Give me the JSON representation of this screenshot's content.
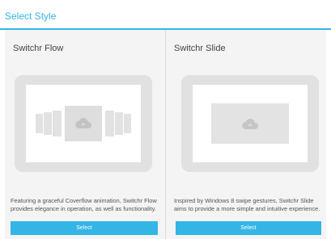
{
  "header": {
    "title": "Select Style"
  },
  "colors": {
    "accent": "#33b5e5"
  },
  "panels": [
    {
      "title": "Switchr Flow",
      "description": "Featuring a graceful Coverflow animation, Switchr Flow provides elegance in operation, as well as functionality.",
      "button_label": "Select",
      "icon": "cloud-icon"
    },
    {
      "title": "Switchr Slide",
      "description": "Inspired by Windows 8 swipe gestures, Switchr Slide aims to provide a more simple and intuitive experience.",
      "button_label": "Select",
      "icon": "cloud-icon"
    }
  ]
}
